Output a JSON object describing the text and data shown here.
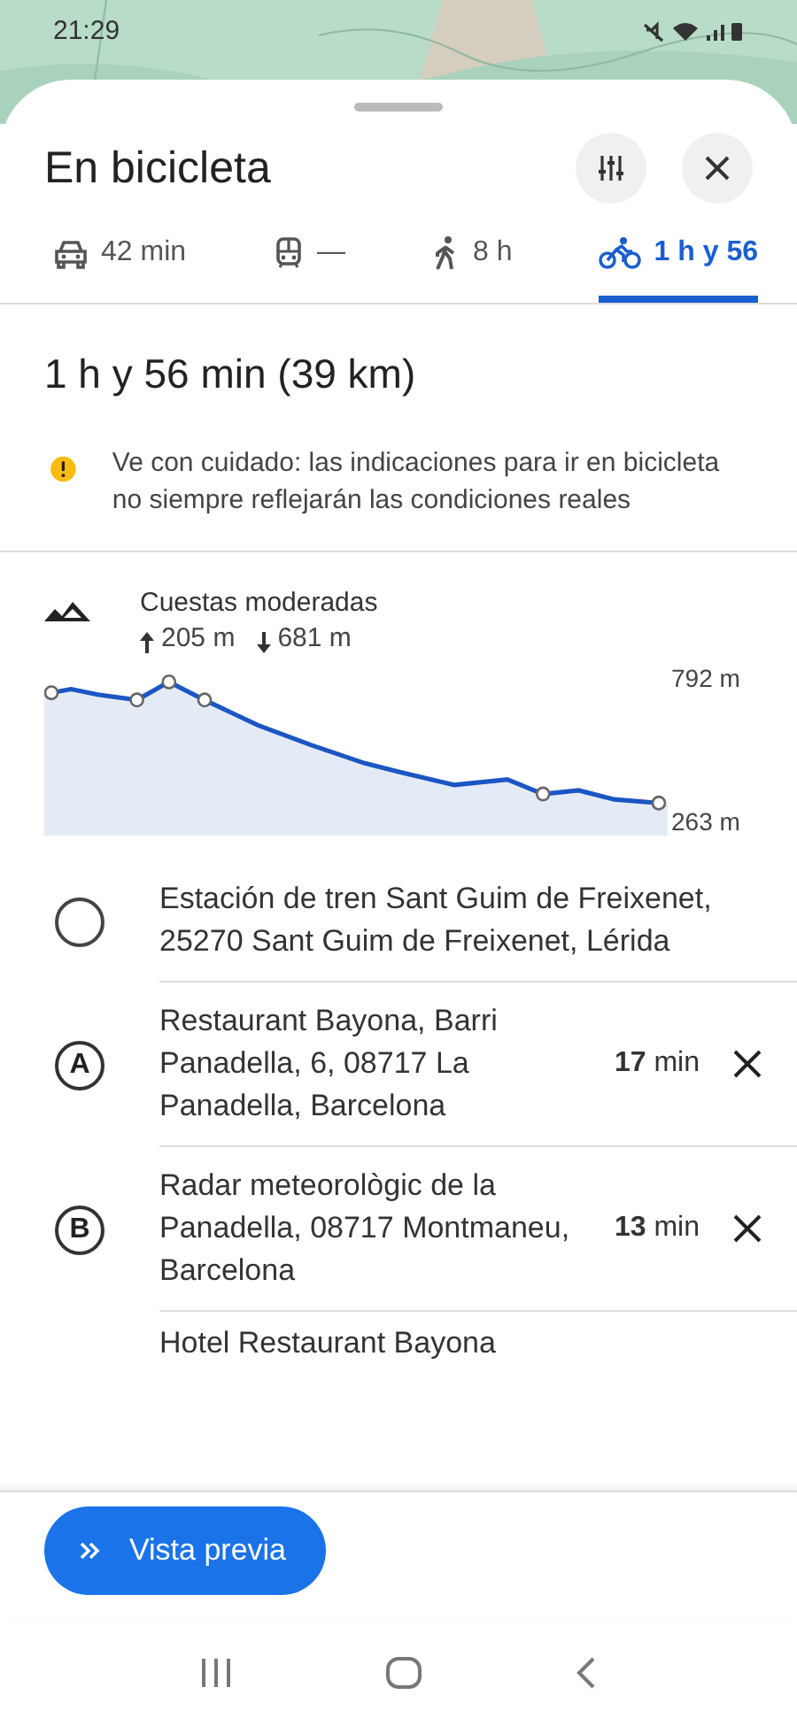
{
  "status_bar": {
    "time": "21:29"
  },
  "header": {
    "title": "En bicicleta"
  },
  "tabs": [
    {
      "kind": "car",
      "label": "42 min",
      "selected": false
    },
    {
      "kind": "transit",
      "label": "—",
      "selected": false
    },
    {
      "kind": "walk",
      "label": "8 h",
      "selected": false
    },
    {
      "kind": "bike",
      "label": "1 h y 56",
      "selected": true
    }
  ],
  "summary": "1 h y 56 min (39 km)",
  "warning": "Ve con cuidado: las indicaciones para ir en bicicleta no siempre reflejarán las condiciones reales",
  "elevation": {
    "title": "Cuestas moderadas",
    "ascent": "205 m",
    "descent": "681 m",
    "max_label": "792 m",
    "min_label": "263 m"
  },
  "stops": [
    {
      "kind": "start",
      "name": "Estación de tren Sant Guim de Freixenet, 25270 Sant Guim de Freixenet, Lérida"
    },
    {
      "kind": "waypoint",
      "letter": "A",
      "name": "Restaurant Bayona, Barri Panadella, 6, 08717 La Panadella, Barcelona",
      "duration": "**17** min"
    },
    {
      "kind": "waypoint",
      "letter": "B",
      "name": "Radar meteorològic de la Panadella, 08717 Montmaneu, Barcelona",
      "duration": "**13** min"
    },
    {
      "kind": "partial",
      "name": "Hotel Restaurant Bayona"
    }
  ],
  "preview_button": {
    "label": "Vista previa"
  }
}
